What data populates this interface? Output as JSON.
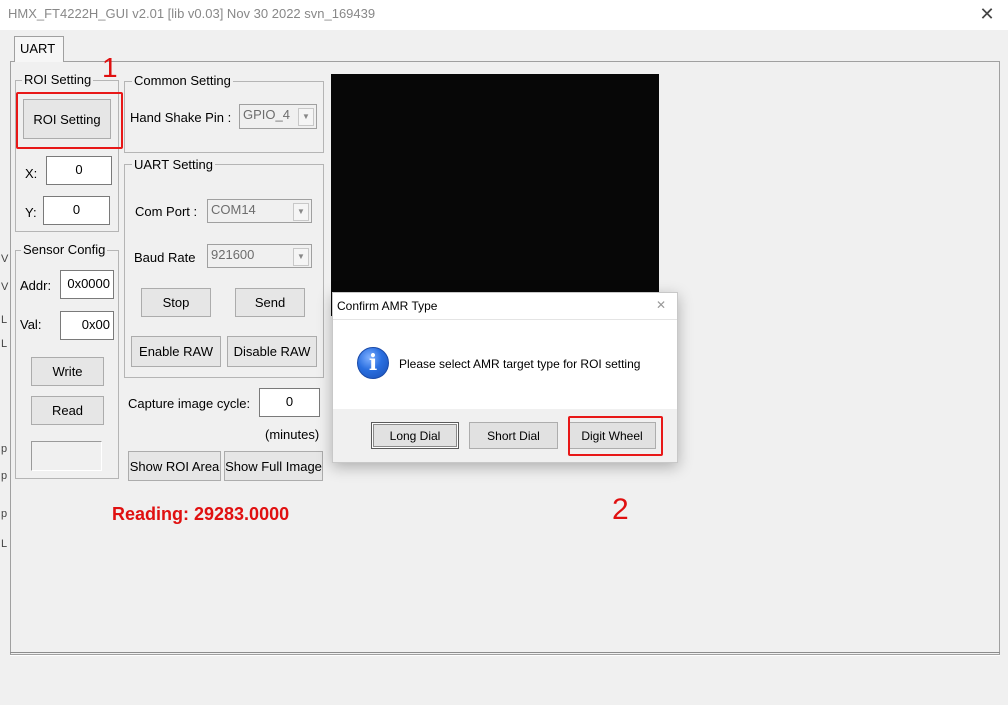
{
  "window": {
    "title": "HMX_FT4222H_GUI v2.01 [lib v0.03] Nov 30 2022 svn_169439",
    "close_glyph": "✕"
  },
  "tabs": [
    {
      "label": "UART",
      "active": true
    }
  ],
  "roi": {
    "group_label": "ROI Setting",
    "button_label": "ROI Setting",
    "x_label": "X:",
    "x_value": "0",
    "y_label": "Y:",
    "y_value": "0"
  },
  "common": {
    "group_label": "Common Setting",
    "hand_shake_label": "Hand Shake Pin :",
    "hand_shake_value": "GPIO_4"
  },
  "uart": {
    "group_label": "UART Setting",
    "com_port_label": "Com Port :",
    "com_port_value": "COM14",
    "baud_rate_label": "Baud Rate",
    "baud_rate_value": "921600",
    "stop_label": "Stop",
    "send_label": "Send",
    "enable_raw_label": "Enable RAW",
    "disable_raw_label": "Disable RAW"
  },
  "sensor": {
    "group_label": "Sensor Config",
    "addr_label": "Addr:",
    "addr_value": "0x0000",
    "val_label": "Val:",
    "val_value": "0x00",
    "write_label": "Write",
    "read_label": "Read",
    "status_value": ""
  },
  "capture": {
    "label": "Capture image cycle:",
    "value": "0",
    "unit": "(minutes)",
    "show_roi_label": "Show ROI Area",
    "show_full_label": "Show Full Image"
  },
  "reading": {
    "text": "Reading: 29283.0000",
    "color": "#e01010"
  },
  "annotations": {
    "step1": "1",
    "step2": "2",
    "color": "#e81818"
  },
  "left_edge_marks": [
    "V",
    "V",
    "L",
    "L",
    "p",
    "p",
    "p",
    "L"
  ],
  "dialog": {
    "title": "Confirm AMR Type",
    "close_glyph": "✕",
    "icon_glyph": "i",
    "message": "Please select AMR target type for ROI setting",
    "buttons": {
      "long_dial": "Long Dial",
      "short_dial": "Short Dial",
      "digit_wheel": "Digit Wheel"
    }
  }
}
